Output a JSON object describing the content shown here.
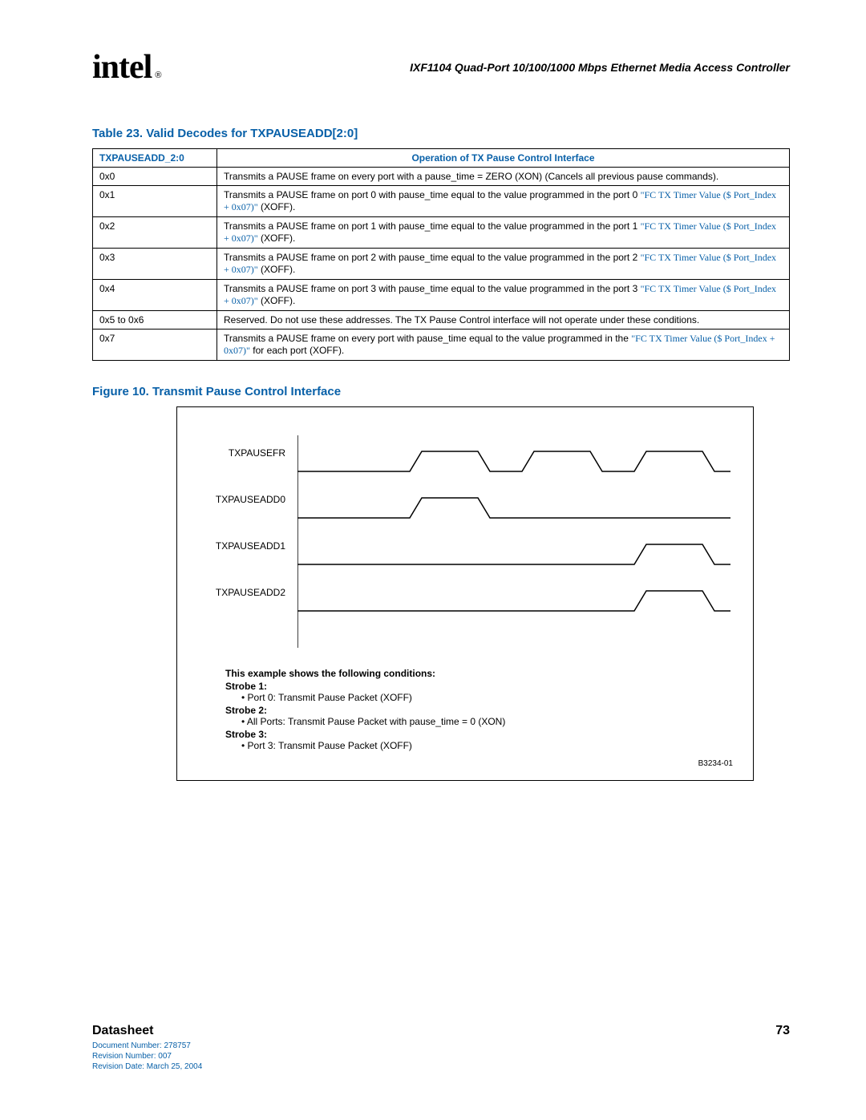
{
  "header": {
    "logo_text": "intel",
    "doc_title": "IXF1104 Quad-Port 10/100/1000 Mbps Ethernet Media Access Controller"
  },
  "table": {
    "caption": "Table 23. Valid Decodes for TXPAUSEADD[2:0]",
    "col1_header": "TXPAUSEADD_2:0",
    "col2_header": "Operation of TX Pause Control Interface",
    "rows": [
      {
        "addr": "0x0",
        "desc_plain": "Transmits a PAUSE frame on every port with a pause_time = ZERO (XON) (Cancels all previous pause commands)."
      },
      {
        "addr": "0x1",
        "desc_pre": "Transmits a PAUSE frame on port 0 with pause_time equal to the value programmed in the port 0 ",
        "desc_link": "\"FC TX Timer Value ($ Port_Index + 0x07)\"",
        "desc_post": " (XOFF)."
      },
      {
        "addr": "0x2",
        "desc_pre": "Transmits a PAUSE frame on port 1 with pause_time equal to the value programmed in the port 1 ",
        "desc_link": "\"FC TX Timer Value ($ Port_Index + 0x07)\"",
        "desc_post": " (XOFF)."
      },
      {
        "addr": "0x3",
        "desc_pre": "Transmits a PAUSE frame on port 2 with pause_time equal to the value programmed in the port 2 ",
        "desc_link": "\"FC TX Timer Value ($ Port_Index + 0x07)\"",
        "desc_post": " (XOFF)."
      },
      {
        "addr": "0x4",
        "desc_pre": "Transmits a PAUSE frame on port 3 with pause_time equal to the value programmed in the port 3 ",
        "desc_link": "\"FC TX Timer Value ($ Port_Index + 0x07)\"",
        "desc_post": " (XOFF)."
      },
      {
        "addr": "0x5 to 0x6",
        "desc_plain": "Reserved. Do not use these addresses. The TX Pause Control interface will not operate under these conditions."
      },
      {
        "addr": "0x7",
        "desc_pre": "Transmits a PAUSE frame on every port with pause_time equal to the value programmed in the ",
        "desc_link": "\"FC TX Timer Value ($ Port_Index + 0x07)\"",
        "desc_post": " for each port (XOFF)."
      }
    ]
  },
  "figure": {
    "caption": "Figure 10. Transmit Pause Control Interface",
    "signals": [
      "TXPAUSEFR",
      "TXPAUSEADD0",
      "TXPAUSEADD1",
      "TXPAUSEADD2"
    ],
    "conditions_heading": "This example shows the following conditions:",
    "strobes": [
      {
        "label": "Strobe 1:",
        "bullet": "Port 0:  Transmit Pause Packet (XOFF)"
      },
      {
        "label": "Strobe 2:",
        "bullet": "All Ports:  Transmit Pause Packet with pause_time = 0 (XON)"
      },
      {
        "label": "Strobe 3:",
        "bullet": "Port 3:  Transmit Pause Packet (XOFF)"
      }
    ],
    "code": "B3234-01"
  },
  "footer": {
    "datasheet": "Datasheet",
    "page": "73",
    "doc_number": "Document Number: 278757",
    "rev_number": "Revision Number: 007",
    "rev_date": "Revision Date: March 25, 2004"
  }
}
